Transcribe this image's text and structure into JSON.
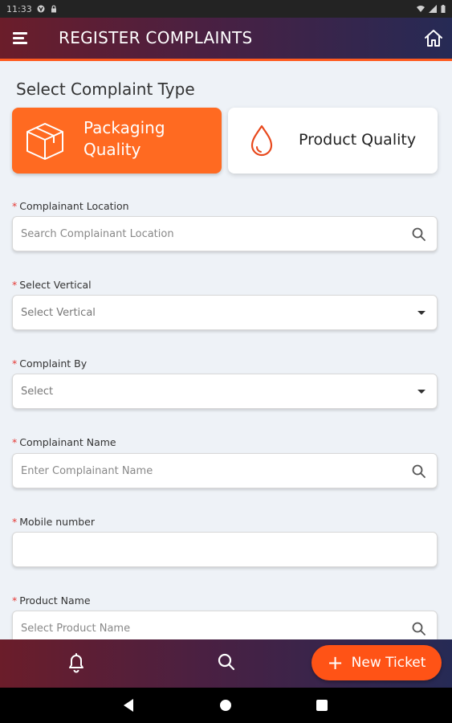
{
  "status_bar": {
    "time": "11:33"
  },
  "app_bar": {
    "title": "REGISTER COMPLAINTS",
    "menu_icon": "menu-icon",
    "home_icon": "home-icon"
  },
  "section_title": "Select Complaint Type",
  "complaint_types": [
    {
      "label_line1": "Packaging",
      "label_line2": "Quality",
      "icon": "package-box-icon",
      "selected": true
    },
    {
      "label": "Product Quality",
      "icon": "water-drop-icon",
      "selected": false
    }
  ],
  "form": {
    "complainant_location": {
      "label": "Complainant Location",
      "placeholder": "Search Complainant Location"
    },
    "vertical": {
      "label": "Select Vertical",
      "value": "Select Vertical"
    },
    "complaint_by": {
      "label": "Complaint By",
      "value": "Select"
    },
    "complainant_name": {
      "label": "Complainant Name",
      "placeholder": "Enter Complainant Name"
    },
    "mobile_number": {
      "label": "Mobile number",
      "placeholder": ""
    },
    "product_name": {
      "label": "Product Name",
      "placeholder": "Select Product Name"
    }
  },
  "required_mark": "*",
  "bottom_bar": {
    "fab_label": "New Ticket",
    "fab_plus": "+"
  },
  "colors": {
    "accent": "#ff6a21",
    "header_start": "#6b1d2a",
    "header_end": "#262a55",
    "required": "#e53935"
  }
}
